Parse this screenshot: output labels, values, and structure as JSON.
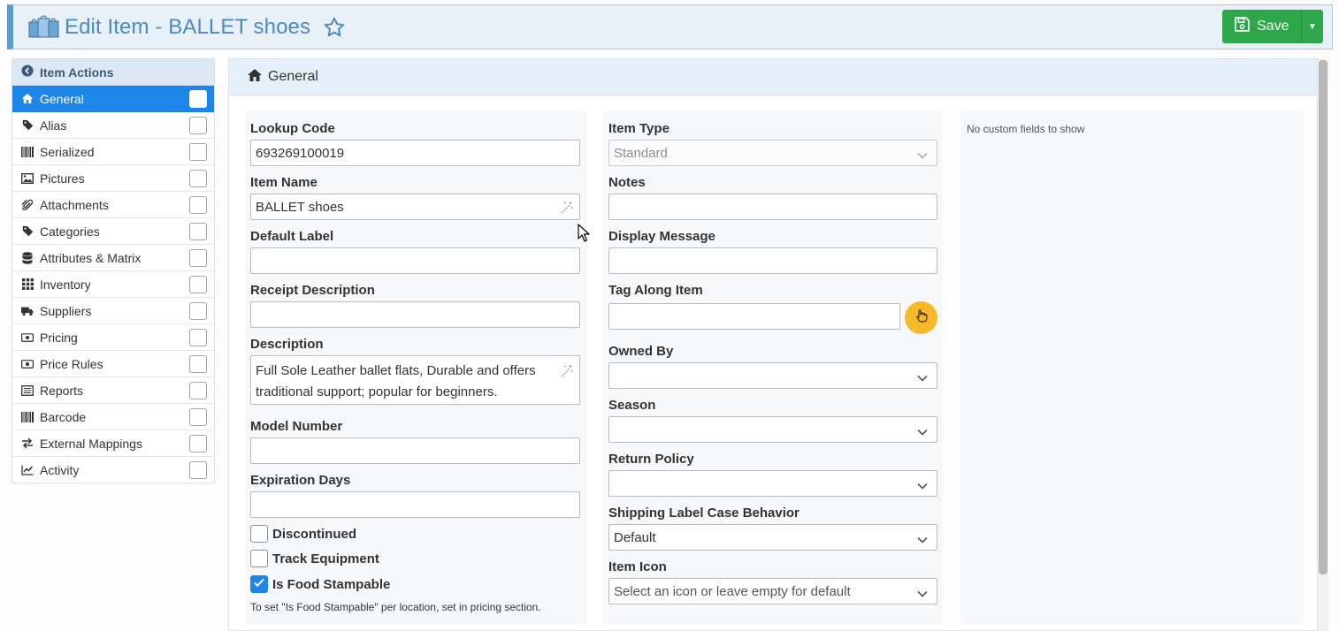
{
  "header": {
    "title": "Edit Item - BALLET shoes",
    "save_label": "Save"
  },
  "sidebar": {
    "heading": "Item Actions",
    "items": [
      {
        "label": "General",
        "icon": "home-icon",
        "active": true
      },
      {
        "label": "Alias",
        "icon": "tag-icon"
      },
      {
        "label": "Serialized",
        "icon": "barcode-icon"
      },
      {
        "label": "Pictures",
        "icon": "image-icon"
      },
      {
        "label": "Attachments",
        "icon": "paperclip-icon"
      },
      {
        "label": "Categories",
        "icon": "tag-icon"
      },
      {
        "label": "Attributes & Matrix",
        "icon": "database-icon"
      },
      {
        "label": "Inventory",
        "icon": "grid-icon"
      },
      {
        "label": "Suppliers",
        "icon": "truck-icon"
      },
      {
        "label": "Pricing",
        "icon": "money-icon"
      },
      {
        "label": "Price Rules",
        "icon": "money-icon"
      },
      {
        "label": "Reports",
        "icon": "list-icon"
      },
      {
        "label": "Barcode",
        "icon": "barcode-icon"
      },
      {
        "label": "External Mappings",
        "icon": "exchange-icon"
      },
      {
        "label": "Activity",
        "icon": "chart-icon"
      }
    ]
  },
  "main": {
    "section_title": "General",
    "left": {
      "lookup_code_label": "Lookup Code",
      "lookup_code_value": "693269100019",
      "item_name_label": "Item Name",
      "item_name_value": "BALLET shoes",
      "default_label_label": "Default Label",
      "default_label_value": "",
      "receipt_description_label": "Receipt Description",
      "receipt_description_value": "",
      "description_label": "Description",
      "description_value": "Full Sole Leather ballet flats, Durable and offers traditional support; popular for beginners.",
      "model_number_label": "Model Number",
      "model_number_value": "",
      "expiration_days_label": "Expiration Days",
      "expiration_days_value": "",
      "discontinued_label": "Discontinued",
      "track_equipment_label": "Track Equipment",
      "food_stampable_label": "Is Food Stampable",
      "food_stampable_note": "To set \"Is Food Stampable\" per location, set in pricing section."
    },
    "middle": {
      "item_type_label": "Item Type",
      "item_type_value": "Standard",
      "notes_label": "Notes",
      "notes_value": "",
      "display_message_label": "Display Message",
      "display_message_value": "",
      "tag_along_label": "Tag Along Item",
      "tag_along_value": "",
      "owned_by_label": "Owned By",
      "owned_by_value": "",
      "season_label": "Season",
      "season_value": "",
      "return_policy_label": "Return Policy",
      "return_policy_value": "",
      "shipping_label_label": "Shipping Label Case Behavior",
      "shipping_label_value": "Default",
      "item_icon_label": "Item Icon",
      "item_icon_placeholder": "Select an icon or leave empty for default"
    },
    "right": {
      "empty_text": "No custom fields to show"
    }
  },
  "colors": {
    "accent": "#1e86e8",
    "save": "#2ea74a",
    "title": "#4a8ac4",
    "hand_button": "#f7b928"
  }
}
